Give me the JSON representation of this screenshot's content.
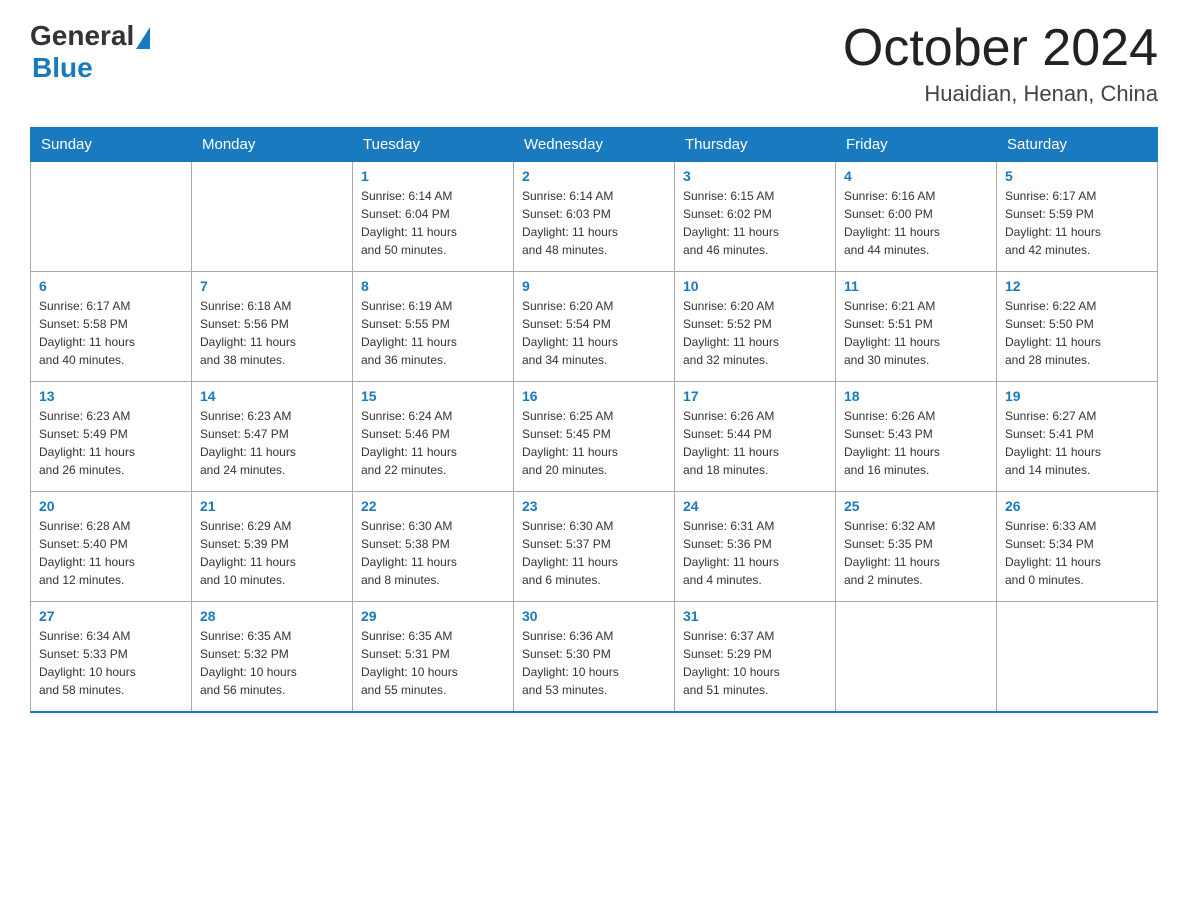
{
  "header": {
    "logo_general": "General",
    "logo_blue": "Blue",
    "month_title": "October 2024",
    "location": "Huaidian, Henan, China"
  },
  "days_of_week": [
    "Sunday",
    "Monday",
    "Tuesday",
    "Wednesday",
    "Thursday",
    "Friday",
    "Saturday"
  ],
  "weeks": [
    [
      {
        "day": "",
        "info": ""
      },
      {
        "day": "",
        "info": ""
      },
      {
        "day": "1",
        "info": "Sunrise: 6:14 AM\nSunset: 6:04 PM\nDaylight: 11 hours\nand 50 minutes."
      },
      {
        "day": "2",
        "info": "Sunrise: 6:14 AM\nSunset: 6:03 PM\nDaylight: 11 hours\nand 48 minutes."
      },
      {
        "day": "3",
        "info": "Sunrise: 6:15 AM\nSunset: 6:02 PM\nDaylight: 11 hours\nand 46 minutes."
      },
      {
        "day": "4",
        "info": "Sunrise: 6:16 AM\nSunset: 6:00 PM\nDaylight: 11 hours\nand 44 minutes."
      },
      {
        "day": "5",
        "info": "Sunrise: 6:17 AM\nSunset: 5:59 PM\nDaylight: 11 hours\nand 42 minutes."
      }
    ],
    [
      {
        "day": "6",
        "info": "Sunrise: 6:17 AM\nSunset: 5:58 PM\nDaylight: 11 hours\nand 40 minutes."
      },
      {
        "day": "7",
        "info": "Sunrise: 6:18 AM\nSunset: 5:56 PM\nDaylight: 11 hours\nand 38 minutes."
      },
      {
        "day": "8",
        "info": "Sunrise: 6:19 AM\nSunset: 5:55 PM\nDaylight: 11 hours\nand 36 minutes."
      },
      {
        "day": "9",
        "info": "Sunrise: 6:20 AM\nSunset: 5:54 PM\nDaylight: 11 hours\nand 34 minutes."
      },
      {
        "day": "10",
        "info": "Sunrise: 6:20 AM\nSunset: 5:52 PM\nDaylight: 11 hours\nand 32 minutes."
      },
      {
        "day": "11",
        "info": "Sunrise: 6:21 AM\nSunset: 5:51 PM\nDaylight: 11 hours\nand 30 minutes."
      },
      {
        "day": "12",
        "info": "Sunrise: 6:22 AM\nSunset: 5:50 PM\nDaylight: 11 hours\nand 28 minutes."
      }
    ],
    [
      {
        "day": "13",
        "info": "Sunrise: 6:23 AM\nSunset: 5:49 PM\nDaylight: 11 hours\nand 26 minutes."
      },
      {
        "day": "14",
        "info": "Sunrise: 6:23 AM\nSunset: 5:47 PM\nDaylight: 11 hours\nand 24 minutes."
      },
      {
        "day": "15",
        "info": "Sunrise: 6:24 AM\nSunset: 5:46 PM\nDaylight: 11 hours\nand 22 minutes."
      },
      {
        "day": "16",
        "info": "Sunrise: 6:25 AM\nSunset: 5:45 PM\nDaylight: 11 hours\nand 20 minutes."
      },
      {
        "day": "17",
        "info": "Sunrise: 6:26 AM\nSunset: 5:44 PM\nDaylight: 11 hours\nand 18 minutes."
      },
      {
        "day": "18",
        "info": "Sunrise: 6:26 AM\nSunset: 5:43 PM\nDaylight: 11 hours\nand 16 minutes."
      },
      {
        "day": "19",
        "info": "Sunrise: 6:27 AM\nSunset: 5:41 PM\nDaylight: 11 hours\nand 14 minutes."
      }
    ],
    [
      {
        "day": "20",
        "info": "Sunrise: 6:28 AM\nSunset: 5:40 PM\nDaylight: 11 hours\nand 12 minutes."
      },
      {
        "day": "21",
        "info": "Sunrise: 6:29 AM\nSunset: 5:39 PM\nDaylight: 11 hours\nand 10 minutes."
      },
      {
        "day": "22",
        "info": "Sunrise: 6:30 AM\nSunset: 5:38 PM\nDaylight: 11 hours\nand 8 minutes."
      },
      {
        "day": "23",
        "info": "Sunrise: 6:30 AM\nSunset: 5:37 PM\nDaylight: 11 hours\nand 6 minutes."
      },
      {
        "day": "24",
        "info": "Sunrise: 6:31 AM\nSunset: 5:36 PM\nDaylight: 11 hours\nand 4 minutes."
      },
      {
        "day": "25",
        "info": "Sunrise: 6:32 AM\nSunset: 5:35 PM\nDaylight: 11 hours\nand 2 minutes."
      },
      {
        "day": "26",
        "info": "Sunrise: 6:33 AM\nSunset: 5:34 PM\nDaylight: 11 hours\nand 0 minutes."
      }
    ],
    [
      {
        "day": "27",
        "info": "Sunrise: 6:34 AM\nSunset: 5:33 PM\nDaylight: 10 hours\nand 58 minutes."
      },
      {
        "day": "28",
        "info": "Sunrise: 6:35 AM\nSunset: 5:32 PM\nDaylight: 10 hours\nand 56 minutes."
      },
      {
        "day": "29",
        "info": "Sunrise: 6:35 AM\nSunset: 5:31 PM\nDaylight: 10 hours\nand 55 minutes."
      },
      {
        "day": "30",
        "info": "Sunrise: 6:36 AM\nSunset: 5:30 PM\nDaylight: 10 hours\nand 53 minutes."
      },
      {
        "day": "31",
        "info": "Sunrise: 6:37 AM\nSunset: 5:29 PM\nDaylight: 10 hours\nand 51 minutes."
      },
      {
        "day": "",
        "info": ""
      },
      {
        "day": "",
        "info": ""
      }
    ]
  ]
}
